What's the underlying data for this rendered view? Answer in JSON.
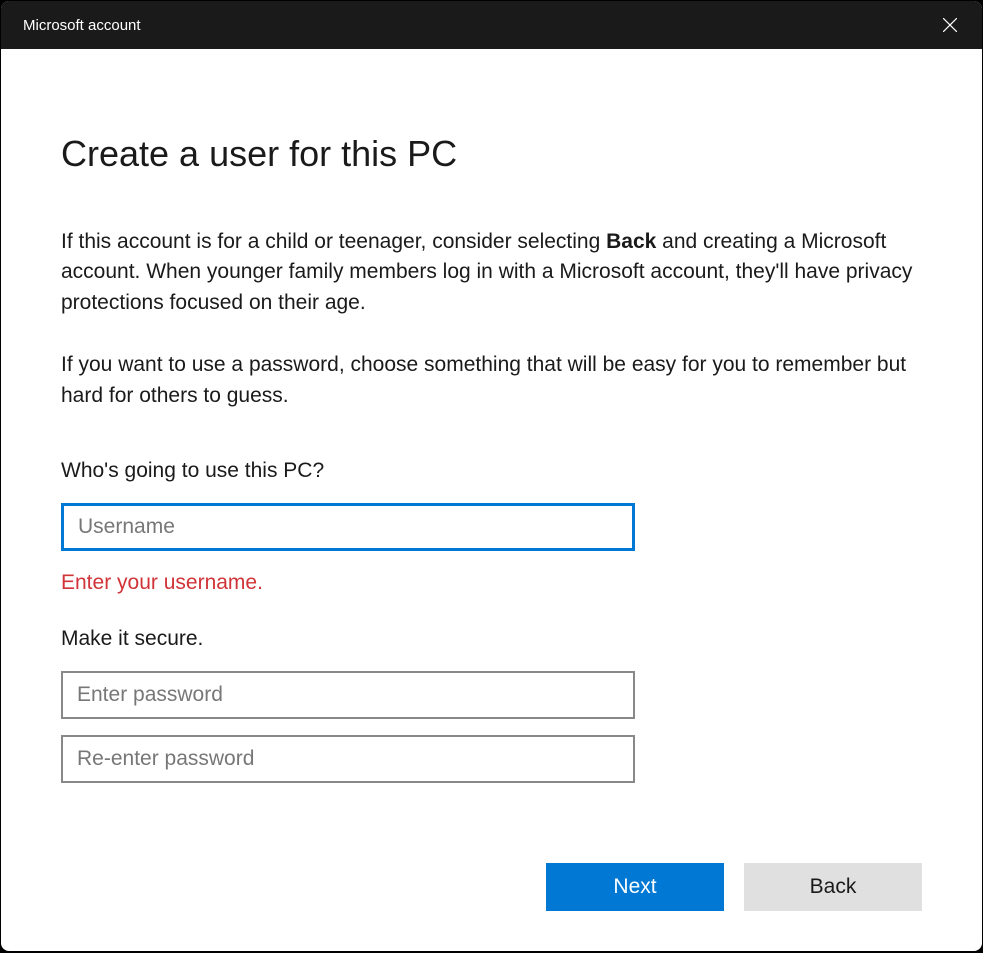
{
  "titlebar": {
    "title": "Microsoft account"
  },
  "page": {
    "title": "Create a user for this PC",
    "description_part1": "If this account is for a child or teenager, consider selecting ",
    "description_bold": "Back",
    "description_part2": " and creating a Microsoft account. When younger family members log in with a Microsoft account, they'll have privacy protections focused on their age.",
    "description2": "If you want to use a password, choose something that will be easy for you to remember but hard for others to guess."
  },
  "form": {
    "username_section_label": "Who's going to use this PC?",
    "username_placeholder": "Username",
    "username_value": "",
    "username_error": "Enter your username.",
    "password_section_label": "Make it secure.",
    "password_placeholder": "Enter password",
    "password_value": "",
    "password_confirm_placeholder": "Re-enter password",
    "password_confirm_value": ""
  },
  "buttons": {
    "next": "Next",
    "back": "Back"
  },
  "colors": {
    "accent": "#0078d4",
    "error": "#d13438",
    "titlebar_bg": "#1a1a1a"
  }
}
